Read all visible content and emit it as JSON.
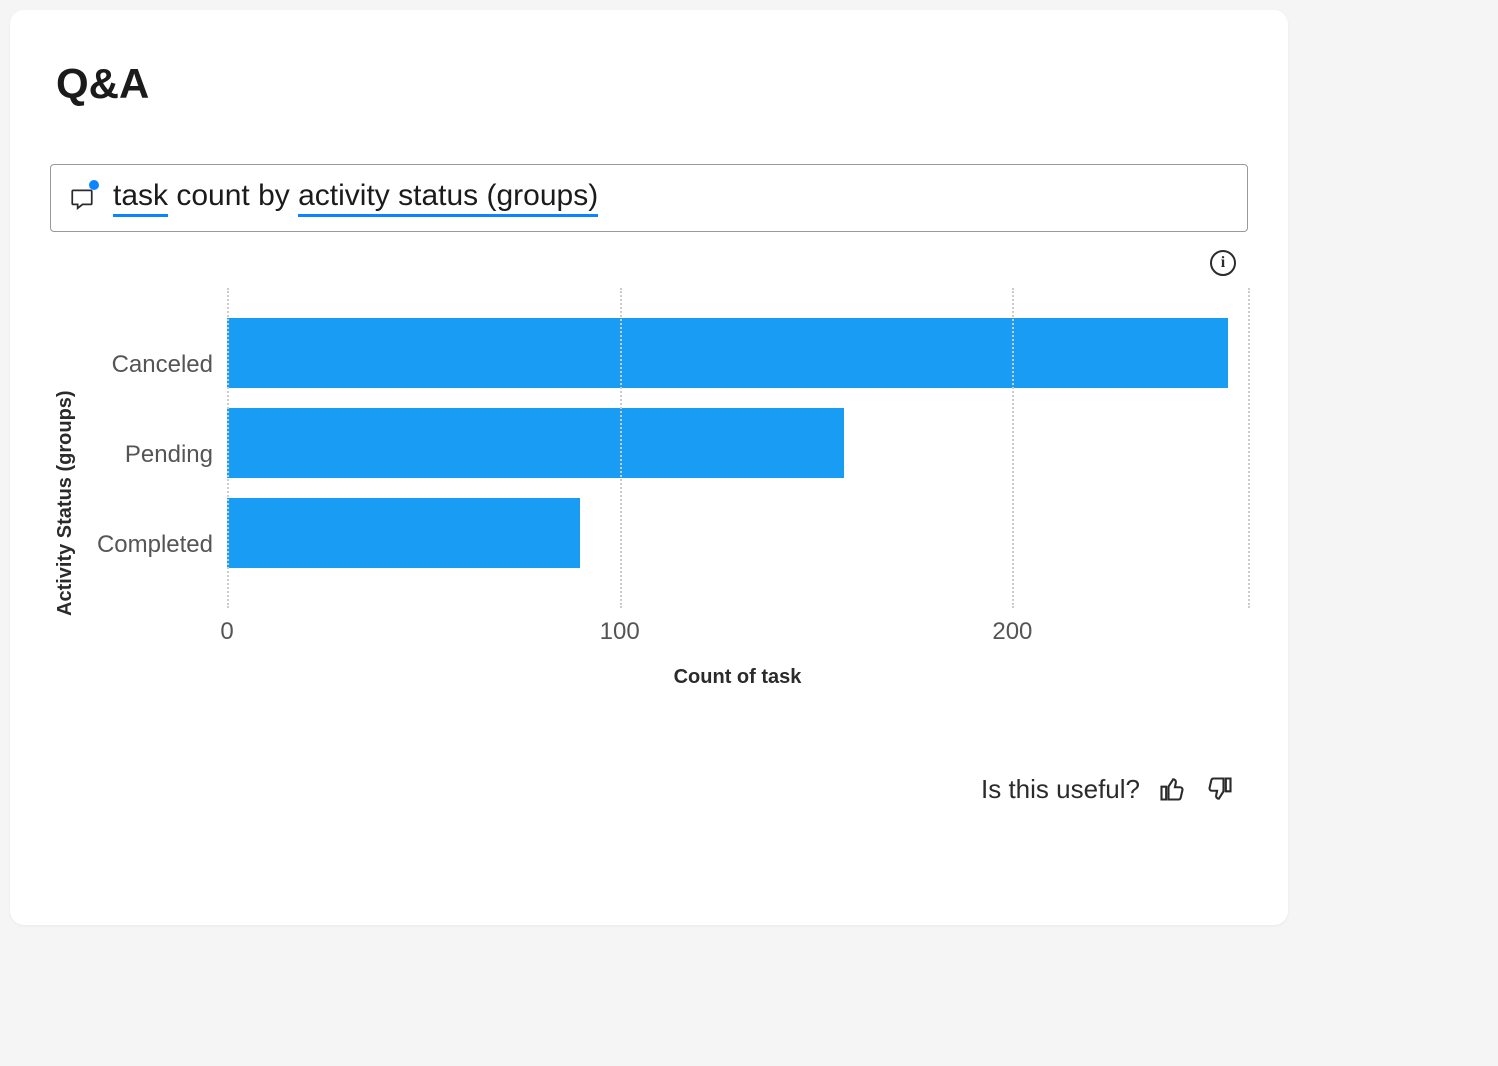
{
  "title": "Q&A",
  "query": {
    "token1": "task",
    "token2": " count by ",
    "token3": "activity status (groups)"
  },
  "feedback": {
    "label": "Is this useful?"
  },
  "chart_data": {
    "type": "bar",
    "orientation": "horizontal",
    "categories": [
      "Canceled",
      "Pending",
      "Completed"
    ],
    "values": [
      255,
      157,
      90
    ],
    "xlabel": "Count of task",
    "ylabel": "Activity Status (groups)",
    "xlim": [
      0,
      260
    ],
    "x_ticks": [
      0,
      100,
      200
    ],
    "bar_color": "#189cf4"
  }
}
